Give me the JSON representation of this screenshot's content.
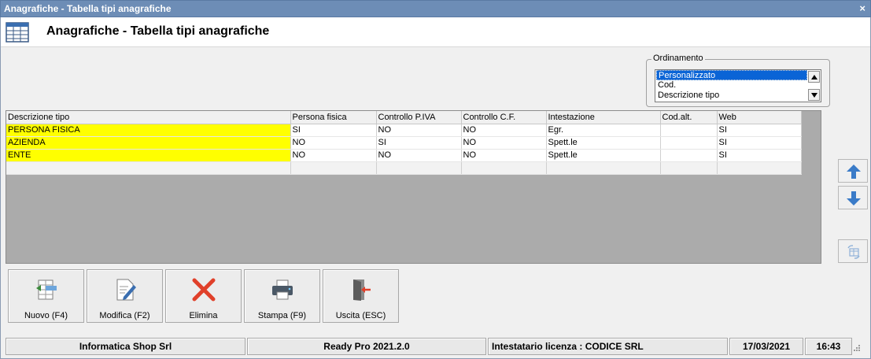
{
  "window": {
    "title": "Anagrafiche - Tabella tipi anagrafiche",
    "close_glyph": "×",
    "header_title": "Anagrafiche - Tabella tipi anagrafiche",
    "header_icon": "table-icon"
  },
  "ordinamento": {
    "legend": "Ordinamento",
    "options": [
      "Personalizzato",
      "Cod.",
      "Descrizione tipo"
    ],
    "selected": "Personalizzato"
  },
  "grid": {
    "columns": [
      "Descrizione tipo",
      "Persona fisica",
      "Controllo P.IVA",
      "Controllo C.F.",
      "Intestazione",
      "Cod.alt.",
      "Web"
    ],
    "rows": [
      [
        "PERSONA FISICA",
        "SI",
        "NO",
        "NO",
        "Egr.",
        "",
        "SI"
      ],
      [
        "AZIENDA",
        "NO",
        "SI",
        "NO",
        "Spett.le",
        "",
        "SI"
      ],
      [
        "ENTE",
        "NO",
        "NO",
        "NO",
        "Spett.le",
        "",
        "SI"
      ]
    ],
    "highlight_color": "#ffff00"
  },
  "side_buttons": {
    "up_icon": "arrow-up-icon",
    "down_icon": "arrow-down-icon",
    "refresh_icon": "refresh-icon",
    "arrow_color": "#3a7bc8"
  },
  "toolbar": {
    "new_label": "Nuovo (F4)",
    "edit_label": "Modifica (F2)",
    "delete_label": "Elimina",
    "print_label": "Stampa (F9)",
    "exit_label": "Uscita (ESC)",
    "delete_color": "#e0402a"
  },
  "status": {
    "company": "Informatica Shop Srl",
    "version": "Ready Pro 2021.2.0",
    "license": "Intestatario licenza : CODICE SRL",
    "date": "17/03/2021",
    "time": "16:43"
  },
  "colors": {
    "titlebar": "#6d8db6",
    "selection": "#0a64d6"
  }
}
